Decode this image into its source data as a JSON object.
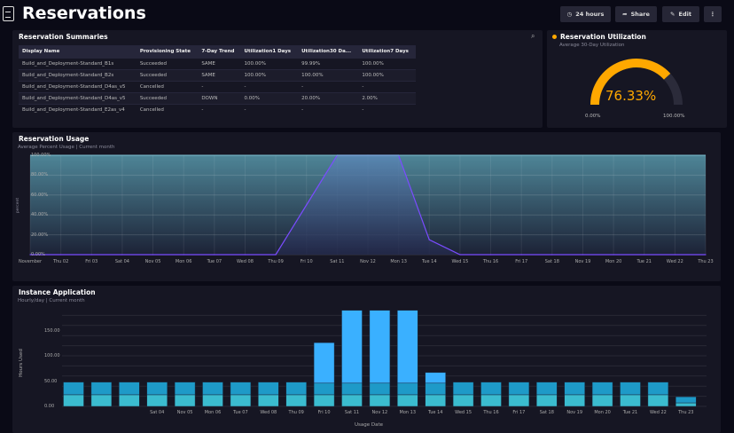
{
  "header": {
    "title": "Reservations",
    "buttons": [
      {
        "label": "24 hours",
        "icon": "clock-icon"
      },
      {
        "label": "Share",
        "icon": "share-icon"
      },
      {
        "label": "Edit",
        "icon": "pencil-icon"
      },
      {
        "label": "⋮",
        "icon": "more-icon"
      }
    ]
  },
  "summaries": {
    "title": "Reservation Summaries",
    "columns": [
      "Display Name",
      "Provisioning State",
      "7-Day Trend",
      "Utilization1 Days",
      "Utilization30 Da...",
      "Utilization7 Days"
    ],
    "rows": [
      [
        "Build_and_Deployment-Standard_B1s",
        "Succeeded",
        "SAME",
        "100.00%",
        "99.99%",
        "100.00%"
      ],
      [
        "Build_and_Deployment-Standard_B2s",
        "Succeeded",
        "SAME",
        "100.00%",
        "100.00%",
        "100.00%"
      ],
      [
        "Build_and_Deployment-Standard_D4as_v5",
        "Cancelled",
        "-",
        "-",
        "-",
        "-"
      ],
      [
        "Build_and_Deployment-Standard_D4as_v5",
        "Succeeded",
        "DOWN",
        "0.00%",
        "20.00%",
        "2.00%"
      ],
      [
        "Build_and_Deployment-Standard_E2as_v4",
        "Cancelled",
        "-",
        "-",
        "-",
        "-"
      ]
    ]
  },
  "utilization": {
    "title": "Reservation Utilization",
    "subtitle": "Average 30-Day Utilization",
    "value": 76.33,
    "value_label": "76.33%",
    "min_label": "0.00%",
    "max_label": "100.00%",
    "accent": "#ffa800"
  },
  "chart_data": [
    {
      "type": "area",
      "title": "Reservation Usage",
      "subtitle": "Average Percent Usage  |  Current month",
      "ylabel": "percent",
      "ylim": [
        0,
        100
      ],
      "yticks": [
        "0.00%",
        "20.00%",
        "40.00%",
        "60.00%",
        "80.00%",
        "100.00%"
      ],
      "categories": [
        "November",
        "Thu 02",
        "Fri 03",
        "Sat 04",
        "Nov 05",
        "Mon 06",
        "Tue 07",
        "Wed 08",
        "Thu 09",
        "Fri 10",
        "Sat 11",
        "Nov 12",
        "Mon 13",
        "Tue 14",
        "Wed 15",
        "Thu 16",
        "Fri 17",
        "Sat 18",
        "Nov 19",
        "Mon 20",
        "Tue 21",
        "Wed 22",
        "Thu 23"
      ],
      "values": [
        0,
        0,
        0,
        0,
        0,
        0,
        0,
        0,
        0,
        50,
        100,
        100,
        100,
        15,
        0,
        0,
        0,
        0,
        0,
        0,
        0,
        0,
        0
      ],
      "line_color": "#7a4cff"
    },
    {
      "type": "bar",
      "stacked": true,
      "title": "Instance Application",
      "subtitle": "Hourly/day  |  Current month",
      "xlabel": "Usage Date",
      "ylabel": "Hours Used",
      "ylim": [
        0,
        190
      ],
      "yticks": [
        "0.00",
        "50.00",
        "100.00",
        "150.00"
      ],
      "categories": [
        "",
        "",
        "",
        "Sat 04",
        "Nov 05",
        "Mon 06",
        "Tue 07",
        "Wed 08",
        "Thu 09",
        "Fri 10",
        "Sat 11",
        "Nov 12",
        "Mon 13",
        "Tue 14",
        "Wed 15",
        "Thu 16",
        "Fri 17",
        "Sat 18",
        "Nov 19",
        "Mon 20",
        "Tue 21",
        "Wed 22",
        "Thu 23"
      ],
      "series": [
        {
          "color": "#3bbccf",
          "values": [
            23,
            23,
            23,
            23,
            23,
            23,
            23,
            23,
            23,
            23,
            23,
            23,
            23,
            23,
            23,
            23,
            23,
            23,
            23,
            23,
            23,
            23,
            7
          ]
        },
        {
          "color": "#1e9ac8",
          "values": [
            25,
            25,
            25,
            25,
            25,
            25,
            25,
            25,
            25,
            23,
            23,
            23,
            23,
            23,
            25,
            25,
            25,
            25,
            25,
            25,
            25,
            25,
            12
          ]
        },
        {
          "color": "#3ab0ff",
          "values": [
            0,
            0,
            0,
            0,
            0,
            0,
            0,
            0,
            0,
            80,
            144,
            144,
            144,
            21,
            0,
            0,
            0,
            0,
            0,
            0,
            0,
            0,
            0
          ]
        }
      ]
    }
  ]
}
